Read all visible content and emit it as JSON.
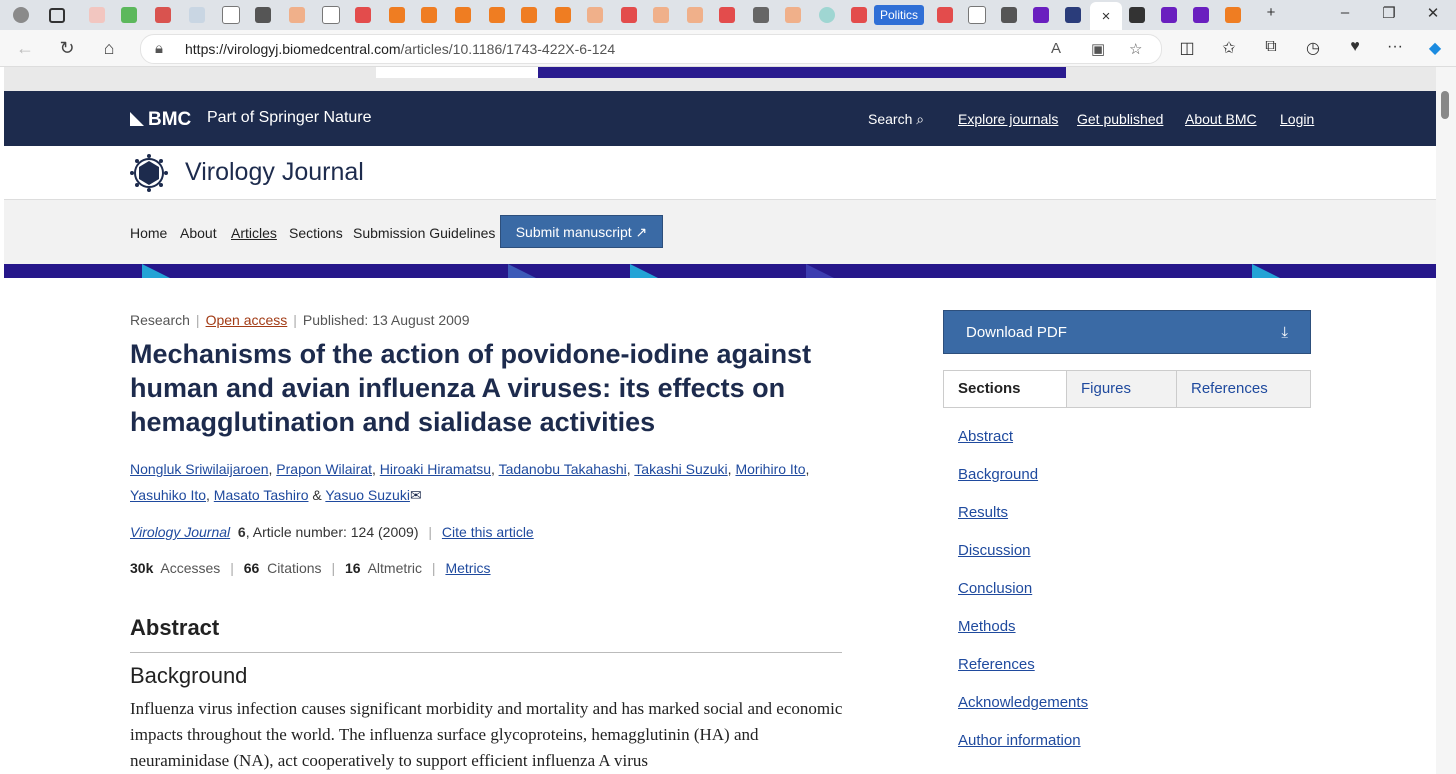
{
  "browser": {
    "tab_label": "Politics",
    "close_tab": "×",
    "url_host": "https://virologyj.biomedcentral.com",
    "url_path": "/articles/10.1186/1743-422X-6-124"
  },
  "bmc": {
    "logo": "BMC",
    "part_of": "Part of Springer Nature",
    "search": "Search",
    "links": [
      "Explore journals",
      "Get published",
      "About BMC",
      "Login"
    ]
  },
  "journal": {
    "title": "Virology Journal"
  },
  "nav": {
    "items": [
      "Home",
      "About",
      "Articles",
      "Sections",
      "Submission Guidelines"
    ],
    "submit": "Submit manuscript"
  },
  "article": {
    "type": "Research",
    "access": "Open access",
    "published": "Published: 13 August 2009",
    "title": "Mechanisms of the action of povidone-iodine against human and avian influenza A viruses: its effects on hemagglutination and sialidase activities",
    "authors": [
      "Nongluk Sriwilaijaroen",
      "Prapon Wilairat",
      "Hiroaki Hiramatsu",
      "Tadanobu Takahashi",
      "Takashi Suzuki",
      "Morihiro Ito",
      "Yasuhiko Ito",
      "Masato Tashiro",
      "Yasuo Suzuki"
    ],
    "amp": "&",
    "journal_name": "Virology Journal",
    "volume": "6",
    "article_number": ", Article number: 124 (2009)",
    "cite": "Cite this article",
    "accesses_n": "30k",
    "accesses_l": "Accesses",
    "citations_n": "66",
    "citations_l": "Citations",
    "altmetric_n": "16",
    "altmetric_l": "Altmetric",
    "metrics": "Metrics",
    "abstract_heading": "Abstract",
    "background_heading": "Background",
    "body": "Influenza virus infection causes significant morbidity and mortality and has marked social and economic impacts throughout the world. The influenza surface glycoproteins, hemagglutinin (HA) and neuraminidase (NA), act cooperatively to support efficient influenza A virus"
  },
  "sidebar": {
    "download": "Download PDF",
    "tabs": [
      "Sections",
      "Figures",
      "References"
    ],
    "sections": [
      "Abstract",
      "Background",
      "Results",
      "Discussion",
      "Conclusion",
      "Methods",
      "References",
      "Acknowledgements",
      "Author information"
    ]
  }
}
